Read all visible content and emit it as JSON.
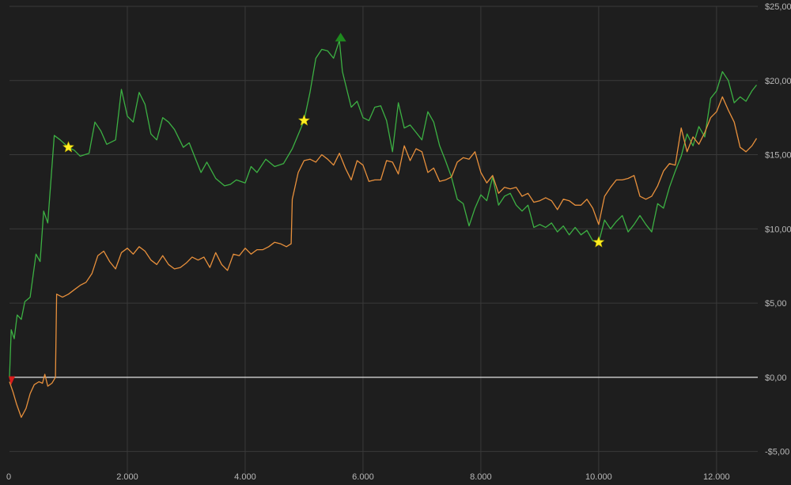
{
  "chart_data": {
    "type": "line",
    "title": "",
    "xlabel": "",
    "ylabel": "",
    "xlim": [
      0,
      12700
    ],
    "ylim": [
      -5.5,
      25
    ],
    "grid": true,
    "x_ticks": [
      {
        "value": 0,
        "label": "0"
      },
      {
        "value": 2000,
        "label": "2.000"
      },
      {
        "value": 4000,
        "label": "4.000"
      },
      {
        "value": 6000,
        "label": "6.000"
      },
      {
        "value": 8000,
        "label": "8.000"
      },
      {
        "value": 10000,
        "label": "10.000"
      },
      {
        "value": 12000,
        "label": "12.000"
      }
    ],
    "y_ticks": [
      {
        "value": 25,
        "label": "$25,00"
      },
      {
        "value": 20,
        "label": "$20,00"
      },
      {
        "value": 15,
        "label": "$15,00"
      },
      {
        "value": 10,
        "label": "$10,00"
      },
      {
        "value": 5,
        "label": "$5,00"
      },
      {
        "value": 0,
        "label": "$0,00"
      },
      {
        "value": -5,
        "label": "-$5,00"
      }
    ],
    "series": [
      {
        "color": "#3cb043",
        "points": [
          [
            0,
            0
          ],
          [
            30,
            3.2
          ],
          [
            80,
            2.6
          ],
          [
            130,
            4.2
          ],
          [
            200,
            3.9
          ],
          [
            260,
            5.1
          ],
          [
            350,
            5.4
          ],
          [
            450,
            8.3
          ],
          [
            520,
            7.8
          ],
          [
            580,
            11.2
          ],
          [
            650,
            10.4
          ],
          [
            760,
            16.3
          ],
          [
            860,
            16.0
          ],
          [
            1000,
            15.5
          ],
          [
            1100,
            15.3
          ],
          [
            1200,
            14.9
          ],
          [
            1350,
            15.1
          ],
          [
            1450,
            17.2
          ],
          [
            1550,
            16.6
          ],
          [
            1650,
            15.7
          ],
          [
            1800,
            16.0
          ],
          [
            1900,
            19.4
          ],
          [
            2000,
            17.6
          ],
          [
            2100,
            17.2
          ],
          [
            2200,
            19.2
          ],
          [
            2300,
            18.4
          ],
          [
            2400,
            16.4
          ],
          [
            2500,
            16.0
          ],
          [
            2600,
            17.5
          ],
          [
            2700,
            17.2
          ],
          [
            2800,
            16.7
          ],
          [
            2950,
            15.5
          ],
          [
            3050,
            15.8
          ],
          [
            3150,
            14.8
          ],
          [
            3250,
            13.8
          ],
          [
            3350,
            14.5
          ],
          [
            3500,
            13.4
          ],
          [
            3650,
            12.9
          ],
          [
            3750,
            13.0
          ],
          [
            3850,
            13.3
          ],
          [
            4000,
            13.1
          ],
          [
            4100,
            14.2
          ],
          [
            4200,
            13.8
          ],
          [
            4350,
            14.7
          ],
          [
            4500,
            14.2
          ],
          [
            4650,
            14.4
          ],
          [
            4800,
            15.4
          ],
          [
            5000,
            17.3
          ],
          [
            5100,
            19.2
          ],
          [
            5200,
            21.5
          ],
          [
            5300,
            22.1
          ],
          [
            5400,
            22.0
          ],
          [
            5500,
            21.5
          ],
          [
            5600,
            22.7
          ],
          [
            5650,
            20.6
          ],
          [
            5700,
            19.8
          ],
          [
            5800,
            18.2
          ],
          [
            5900,
            18.6
          ],
          [
            6000,
            17.5
          ],
          [
            6100,
            17.3
          ],
          [
            6200,
            18.2
          ],
          [
            6300,
            18.3
          ],
          [
            6400,
            17.3
          ],
          [
            6500,
            15.2
          ],
          [
            6600,
            18.5
          ],
          [
            6700,
            16.8
          ],
          [
            6800,
            17.0
          ],
          [
            6900,
            16.5
          ],
          [
            7000,
            16.0
          ],
          [
            7100,
            17.9
          ],
          [
            7200,
            17.2
          ],
          [
            7300,
            15.6
          ],
          [
            7400,
            14.6
          ],
          [
            7500,
            13.5
          ],
          [
            7600,
            12.0
          ],
          [
            7700,
            11.7
          ],
          [
            7800,
            10.2
          ],
          [
            7900,
            11.4
          ],
          [
            8000,
            12.3
          ],
          [
            8100,
            11.9
          ],
          [
            8200,
            13.5
          ],
          [
            8300,
            11.6
          ],
          [
            8400,
            12.2
          ],
          [
            8500,
            12.4
          ],
          [
            8600,
            11.6
          ],
          [
            8700,
            11.2
          ],
          [
            8800,
            11.6
          ],
          [
            8900,
            10.1
          ],
          [
            9000,
            10.3
          ],
          [
            9100,
            10.1
          ],
          [
            9200,
            10.4
          ],
          [
            9300,
            9.8
          ],
          [
            9400,
            10.2
          ],
          [
            9500,
            9.6
          ],
          [
            9600,
            10.1
          ],
          [
            9700,
            9.6
          ],
          [
            9800,
            9.9
          ],
          [
            9900,
            9.2
          ],
          [
            10000,
            9.1
          ],
          [
            10100,
            10.6
          ],
          [
            10200,
            10.0
          ],
          [
            10300,
            10.5
          ],
          [
            10400,
            10.9
          ],
          [
            10500,
            9.8
          ],
          [
            10600,
            10.3
          ],
          [
            10700,
            10.9
          ],
          [
            10800,
            10.3
          ],
          [
            10900,
            9.8
          ],
          [
            11000,
            11.7
          ],
          [
            11100,
            11.4
          ],
          [
            11200,
            12.8
          ],
          [
            11300,
            13.9
          ],
          [
            11400,
            14.9
          ],
          [
            11500,
            16.4
          ],
          [
            11600,
            15.6
          ],
          [
            11700,
            16.9
          ],
          [
            11800,
            16.2
          ],
          [
            11900,
            18.8
          ],
          [
            12000,
            19.3
          ],
          [
            12100,
            20.6
          ],
          [
            12200,
            20.0
          ],
          [
            12300,
            18.5
          ],
          [
            12400,
            18.9
          ],
          [
            12500,
            18.6
          ],
          [
            12600,
            19.3
          ],
          [
            12680,
            19.7
          ]
        ]
      },
      {
        "color": "#e8903c",
        "points": [
          [
            0,
            -0.3
          ],
          [
            60,
            -1.0
          ],
          [
            120,
            -1.8
          ],
          [
            200,
            -2.7
          ],
          [
            280,
            -2.1
          ],
          [
            350,
            -1.1
          ],
          [
            420,
            -0.5
          ],
          [
            500,
            -0.3
          ],
          [
            560,
            -0.4
          ],
          [
            600,
            0.2
          ],
          [
            650,
            -0.6
          ],
          [
            720,
            -0.4
          ],
          [
            780,
            0
          ],
          [
            800,
            5.6
          ],
          [
            900,
            5.4
          ],
          [
            1000,
            5.6
          ],
          [
            1100,
            5.9
          ],
          [
            1200,
            6.2
          ],
          [
            1300,
            6.4
          ],
          [
            1400,
            7.0
          ],
          [
            1500,
            8.2
          ],
          [
            1600,
            8.5
          ],
          [
            1700,
            7.8
          ],
          [
            1800,
            7.3
          ],
          [
            1900,
            8.4
          ],
          [
            2000,
            8.7
          ],
          [
            2100,
            8.3
          ],
          [
            2200,
            8.8
          ],
          [
            2300,
            8.5
          ],
          [
            2400,
            7.9
          ],
          [
            2500,
            7.6
          ],
          [
            2600,
            8.2
          ],
          [
            2700,
            7.6
          ],
          [
            2800,
            7.3
          ],
          [
            2900,
            7.4
          ],
          [
            3000,
            7.7
          ],
          [
            3100,
            8.1
          ],
          [
            3200,
            7.9
          ],
          [
            3300,
            8.1
          ],
          [
            3400,
            7.4
          ],
          [
            3500,
            8.4
          ],
          [
            3600,
            7.6
          ],
          [
            3700,
            7.2
          ],
          [
            3800,
            8.3
          ],
          [
            3900,
            8.2
          ],
          [
            4000,
            8.7
          ],
          [
            4100,
            8.3
          ],
          [
            4200,
            8.6
          ],
          [
            4300,
            8.6
          ],
          [
            4400,
            8.8
          ],
          [
            4500,
            9.1
          ],
          [
            4600,
            9.0
          ],
          [
            4700,
            8.8
          ],
          [
            4780,
            9.0
          ],
          [
            4800,
            12.0
          ],
          [
            4900,
            13.8
          ],
          [
            5000,
            14.6
          ],
          [
            5100,
            14.7
          ],
          [
            5200,
            14.5
          ],
          [
            5300,
            15.0
          ],
          [
            5400,
            14.7
          ],
          [
            5500,
            14.3
          ],
          [
            5600,
            15.1
          ],
          [
            5700,
            14.1
          ],
          [
            5800,
            13.3
          ],
          [
            5900,
            14.6
          ],
          [
            6000,
            14.3
          ],
          [
            6100,
            13.2
          ],
          [
            6200,
            13.3
          ],
          [
            6300,
            13.3
          ],
          [
            6400,
            14.6
          ],
          [
            6500,
            14.5
          ],
          [
            6600,
            13.7
          ],
          [
            6700,
            15.6
          ],
          [
            6800,
            14.6
          ],
          [
            6900,
            15.4
          ],
          [
            7000,
            15.2
          ],
          [
            7100,
            13.8
          ],
          [
            7200,
            14.1
          ],
          [
            7300,
            13.2
          ],
          [
            7400,
            13.3
          ],
          [
            7500,
            13.5
          ],
          [
            7600,
            14.5
          ],
          [
            7700,
            14.8
          ],
          [
            7800,
            14.7
          ],
          [
            7900,
            15.2
          ],
          [
            8000,
            13.8
          ],
          [
            8100,
            13.1
          ],
          [
            8200,
            13.6
          ],
          [
            8300,
            12.4
          ],
          [
            8400,
            12.8
          ],
          [
            8500,
            12.7
          ],
          [
            8600,
            12.8
          ],
          [
            8700,
            12.2
          ],
          [
            8800,
            12.4
          ],
          [
            8900,
            11.8
          ],
          [
            9000,
            11.9
          ],
          [
            9100,
            12.1
          ],
          [
            9200,
            11.9
          ],
          [
            9300,
            11.3
          ],
          [
            9400,
            12.0
          ],
          [
            9500,
            11.9
          ],
          [
            9600,
            11.6
          ],
          [
            9700,
            11.6
          ],
          [
            9800,
            12.0
          ],
          [
            9900,
            11.4
          ],
          [
            10000,
            10.3
          ],
          [
            10100,
            12.2
          ],
          [
            10200,
            12.8
          ],
          [
            10300,
            13.3
          ],
          [
            10400,
            13.3
          ],
          [
            10500,
            13.4
          ],
          [
            10600,
            13.6
          ],
          [
            10700,
            12.2
          ],
          [
            10800,
            12.0
          ],
          [
            10900,
            12.2
          ],
          [
            11000,
            12.9
          ],
          [
            11100,
            13.9
          ],
          [
            11200,
            14.4
          ],
          [
            11300,
            14.3
          ],
          [
            11400,
            16.8
          ],
          [
            11500,
            15.2
          ],
          [
            11600,
            16.2
          ],
          [
            11700,
            15.7
          ],
          [
            11800,
            16.5
          ],
          [
            11900,
            17.5
          ],
          [
            12000,
            17.9
          ],
          [
            12100,
            18.9
          ],
          [
            12200,
            18.0
          ],
          [
            12300,
            17.2
          ],
          [
            12400,
            15.5
          ],
          [
            12500,
            15.2
          ],
          [
            12600,
            15.6
          ],
          [
            12680,
            16.1
          ]
        ]
      }
    ],
    "markers": [
      {
        "kind": "star",
        "x": 1000,
        "y": 15.5,
        "color": "#ffee22"
      },
      {
        "kind": "star",
        "x": 5000,
        "y": 17.3,
        "color": "#ffee22"
      },
      {
        "kind": "star",
        "x": 10000,
        "y": 9.1,
        "color": "#ffee22"
      },
      {
        "kind": "triangle-up",
        "x": 5620,
        "y": 22.9,
        "color": "#1e8a1e"
      },
      {
        "kind": "triangle-down",
        "x": 0,
        "y": -0.2,
        "color": "#d91c1c"
      }
    ],
    "colors": {
      "background": "#1e1e1e",
      "grid": "#3a3a3a",
      "zero_line": "#e6e6e6",
      "tick_text": "#b9b9b9"
    }
  }
}
